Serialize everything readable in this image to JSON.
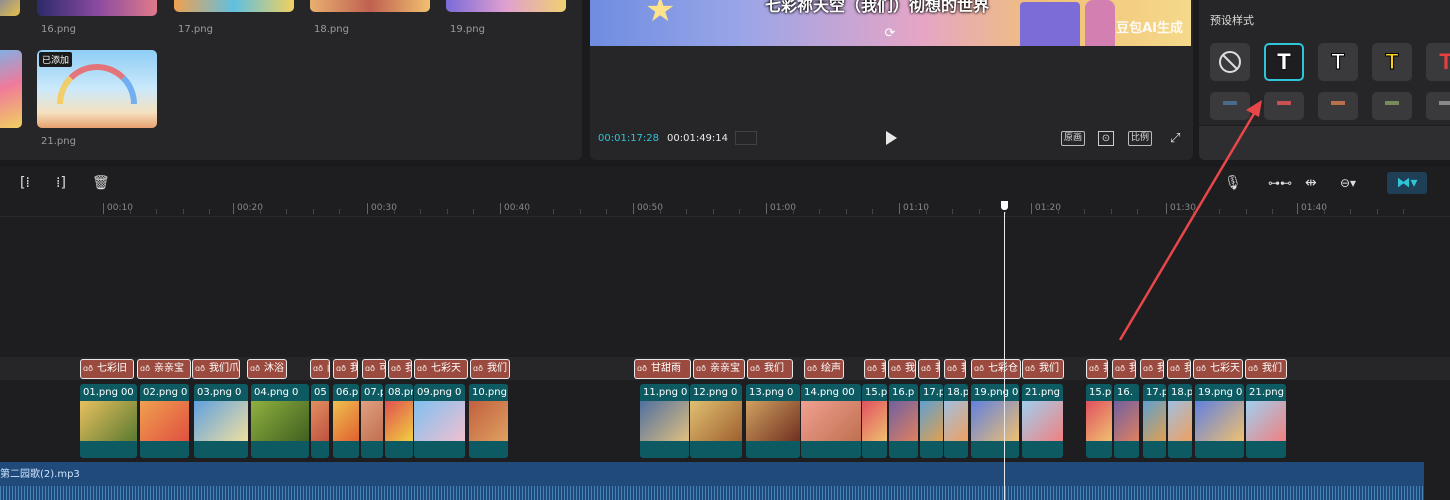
{
  "media": {
    "items": [
      {
        "label": "16.png",
        "added": false
      },
      {
        "label": "17.png",
        "added": false
      },
      {
        "label": "18.png",
        "added": false
      },
      {
        "label": "19.png",
        "added": false
      },
      {
        "label": "21.png",
        "added": true
      }
    ],
    "added_badge": "已添加"
  },
  "player": {
    "subtitle": "七彩祢天空（我们）彻想的世界",
    "watermark": "豆包AI生成",
    "current_time": "00:01:17:28",
    "total_time": "00:01:49:14",
    "original_label": "原画",
    "ratio_label": "比例"
  },
  "style_panel": {
    "title": "预设样式",
    "tiles": [
      {
        "kind": "none",
        "glyph": "⃠"
      },
      {
        "kind": "white-outline",
        "glyph": "T",
        "selected": true
      },
      {
        "kind": "white-stroke",
        "glyph": "T"
      },
      {
        "kind": "yellow",
        "glyph": "T"
      },
      {
        "kind": "red",
        "glyph": "T"
      }
    ],
    "row2_colors": [
      "#4a6a8a",
      "#c85050",
      "#b8704a",
      "#7a8a5a",
      "#888"
    ]
  },
  "ruler": {
    "labels": [
      "00:10",
      "00:20",
      "00:30",
      "00:40",
      "00:50",
      "01:00",
      "01:10",
      "01:20",
      "01:30",
      "01:40"
    ]
  },
  "text_clips": [
    {
      "label": "七彩旧"
    },
    {
      "label": "亲亲宝"
    },
    {
      "label": "我们爪"
    },
    {
      "label": "沐浴"
    },
    {
      "label": "闪"
    },
    {
      "label": "我"
    },
    {
      "label": "可"
    },
    {
      "label": "我"
    },
    {
      "label": "七彩天"
    },
    {
      "label": "我们"
    },
    {
      "label": "甘甜雨"
    },
    {
      "label": "亲亲宝"
    },
    {
      "label": "我们"
    },
    {
      "label": "绘声"
    },
    {
      "label": "我"
    },
    {
      "label": "我"
    },
    {
      "label": "我"
    },
    {
      "label": "我"
    },
    {
      "label": "七彩仓"
    },
    {
      "label": "我们"
    },
    {
      "label": "我"
    },
    {
      "label": "我"
    },
    {
      "label": "我"
    },
    {
      "label": "我"
    },
    {
      "label": "七彩天"
    },
    {
      "label": "我们"
    }
  ],
  "video_clips": [
    {
      "label": "01.png",
      "suffix": "00"
    },
    {
      "label": "02.png",
      "suffix": "0"
    },
    {
      "label": "03.png",
      "suffix": "0"
    },
    {
      "label": "04.png",
      "suffix": "0"
    },
    {
      "label": "05",
      "suffix": ""
    },
    {
      "label": "06.pn",
      "suffix": ""
    },
    {
      "label": "07.p",
      "suffix": ""
    },
    {
      "label": "08.pn",
      "suffix": ""
    },
    {
      "label": "09.png",
      "suffix": "0"
    },
    {
      "label": "10.png",
      "suffix": ""
    },
    {
      "label": "11.png",
      "suffix": "0"
    },
    {
      "label": "12.png",
      "suffix": "0"
    },
    {
      "label": "13.png",
      "suffix": "0"
    },
    {
      "label": "14.png",
      "suffix": "00"
    },
    {
      "label": "15.p",
      "suffix": ""
    },
    {
      "label": "16.p",
      "suffix": ""
    },
    {
      "label": "17.p",
      "suffix": ""
    },
    {
      "label": "18.p",
      "suffix": ""
    },
    {
      "label": "19.png",
      "suffix": "0"
    },
    {
      "label": "21.png",
      "suffix": ""
    },
    {
      "label": "15.p",
      "suffix": ""
    },
    {
      "label": "16.",
      "suffix": ""
    },
    {
      "label": "17.p",
      "suffix": ""
    },
    {
      "label": "18.p",
      "suffix": ""
    },
    {
      "label": "19.png",
      "suffix": "0"
    },
    {
      "label": "21.png",
      "suffix": ""
    }
  ],
  "audio": {
    "label": "第二园歌(2).mp3"
  },
  "colors": {
    "accent": "#2fc4d6",
    "text_clip": "#9a4a3e",
    "video_clip": "#0e5a63",
    "audio": "#1f4a7a",
    "arrow": "#e8474a"
  }
}
